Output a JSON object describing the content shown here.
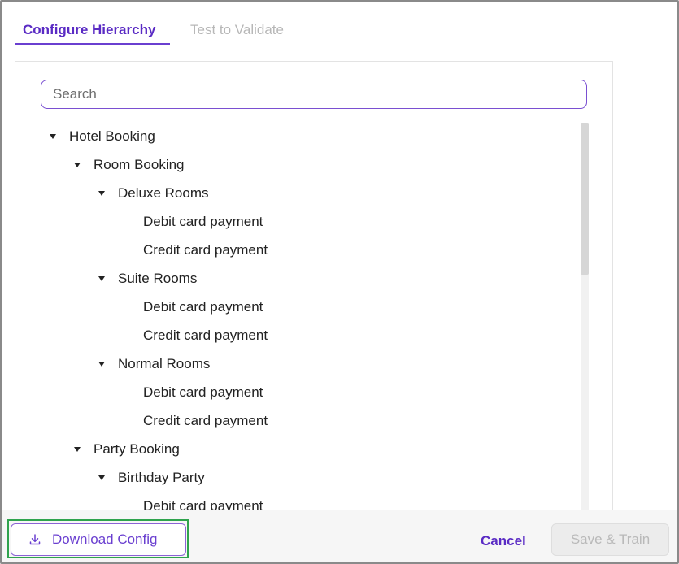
{
  "tabs": [
    {
      "label": "Configure Hierarchy",
      "active": true
    },
    {
      "label": "Test to Validate",
      "active": false
    }
  ],
  "search": {
    "placeholder": "Search",
    "value": ""
  },
  "tree": [
    {
      "label": "Hotel Booking",
      "level": 0,
      "expanded": true
    },
    {
      "label": "Room Booking",
      "level": 1,
      "expanded": true
    },
    {
      "label": "Deluxe Rooms",
      "level": 2,
      "expanded": true
    },
    {
      "label": "Debit card payment",
      "level": 3
    },
    {
      "label": "Credit card payment",
      "level": 3
    },
    {
      "label": "Suite Rooms",
      "level": 2,
      "expanded": true
    },
    {
      "label": "Debit card payment",
      "level": 3
    },
    {
      "label": "Credit card payment",
      "level": 3
    },
    {
      "label": "Normal Rooms",
      "level": 2,
      "expanded": true
    },
    {
      "label": "Debit card payment",
      "level": 3
    },
    {
      "label": "Credit card payment",
      "level": 3
    },
    {
      "label": "Party Booking",
      "level": 1,
      "expanded": true
    },
    {
      "label": "Birthday Party",
      "level": 2,
      "expanded": true
    },
    {
      "label": "Debit card payment",
      "level": 3
    }
  ],
  "footer": {
    "download_label": "Download Config",
    "download_icon": "download-icon",
    "cancel_label": "Cancel",
    "save_label": "Save & Train",
    "save_disabled": true
  },
  "colors": {
    "accent": "#5a2bc4",
    "highlight": "#2fa34d",
    "disabled": "#ececec"
  }
}
